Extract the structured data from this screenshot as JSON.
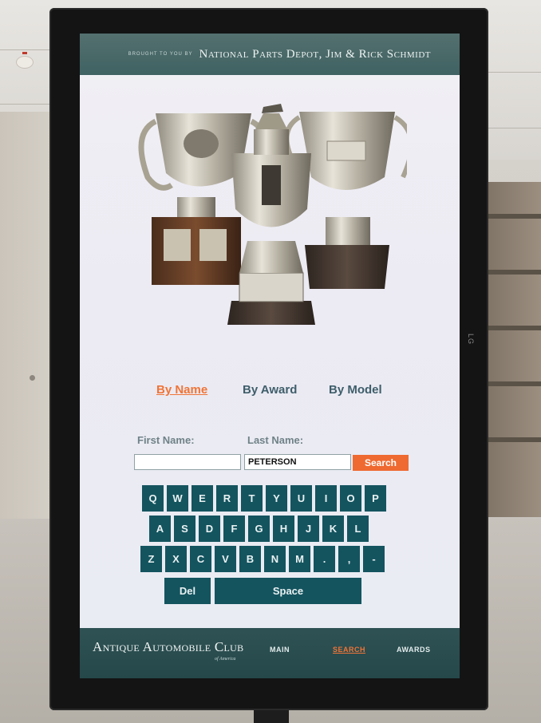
{
  "header": {
    "brought_to_you_by": "BROUGHT TO YOU BY",
    "sponsor": "National Parts Depot, Jim & Rick Schmidt"
  },
  "search_tabs": [
    {
      "label": "By Name",
      "active": true
    },
    {
      "label": "By Award",
      "active": false
    },
    {
      "label": "By Model",
      "active": false
    }
  ],
  "form": {
    "first_name_label": "First Name:",
    "last_name_label": "Last Name:",
    "first_name_value": "",
    "last_name_value": "PETERSON",
    "search_button": "Search"
  },
  "keyboard": {
    "row1": [
      "Q",
      "W",
      "E",
      "R",
      "T",
      "Y",
      "U",
      "I",
      "O",
      "P"
    ],
    "row2": [
      "A",
      "S",
      "D",
      "F",
      "G",
      "H",
      "J",
      "K",
      "L"
    ],
    "row3": [
      "Z",
      "X",
      "C",
      "V",
      "B",
      "N",
      "M",
      ".",
      ",",
      "-"
    ],
    "del": "Del",
    "space": "Space"
  },
  "footer": {
    "club_name": "Antique Automobile Club",
    "club_sub": "of America",
    "nav": [
      {
        "label": "MAIN",
        "active": false
      },
      {
        "label": "SEARCH",
        "active": true
      },
      {
        "label": "AWARDS",
        "active": false
      }
    ]
  },
  "device_brand": "LG",
  "colors": {
    "accent": "#f07436",
    "key_bg": "#14545f",
    "bar_bg": "#2f5254",
    "tab_text": "#3e5e6a"
  }
}
